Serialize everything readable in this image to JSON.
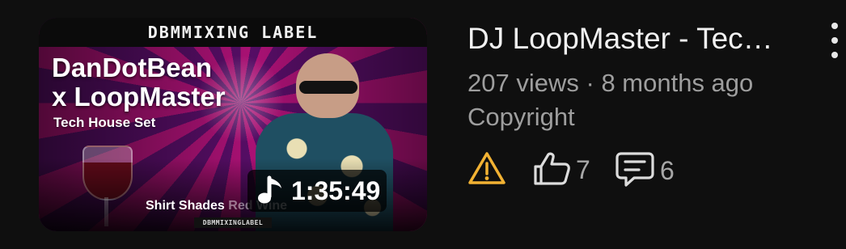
{
  "thumbnail": {
    "top_banner": "DBMMIXING LABEL",
    "title_line1": "DanDotBean",
    "title_line2": "x LoopMaster",
    "subtitle": "Tech House Set",
    "tags_main": "Shirt Shades",
    "tags_faded": "Red Wine",
    "mini_label": "DBMMIXINGLABEL",
    "duration": "1:35:49",
    "duration_icon": "music-note-icon"
  },
  "video": {
    "title": "DJ LoopMaster - Tec…",
    "views": "207 views",
    "separator": "·",
    "age": "8 months ago",
    "status": "Copyright"
  },
  "actions": {
    "warning_icon": "warning-icon",
    "warning_color": "#f2b233",
    "like_icon": "thumbs-up-icon",
    "likes": "7",
    "comment_icon": "comment-icon",
    "comments": "6"
  },
  "menu": {
    "icon": "more-vertical-icon"
  }
}
